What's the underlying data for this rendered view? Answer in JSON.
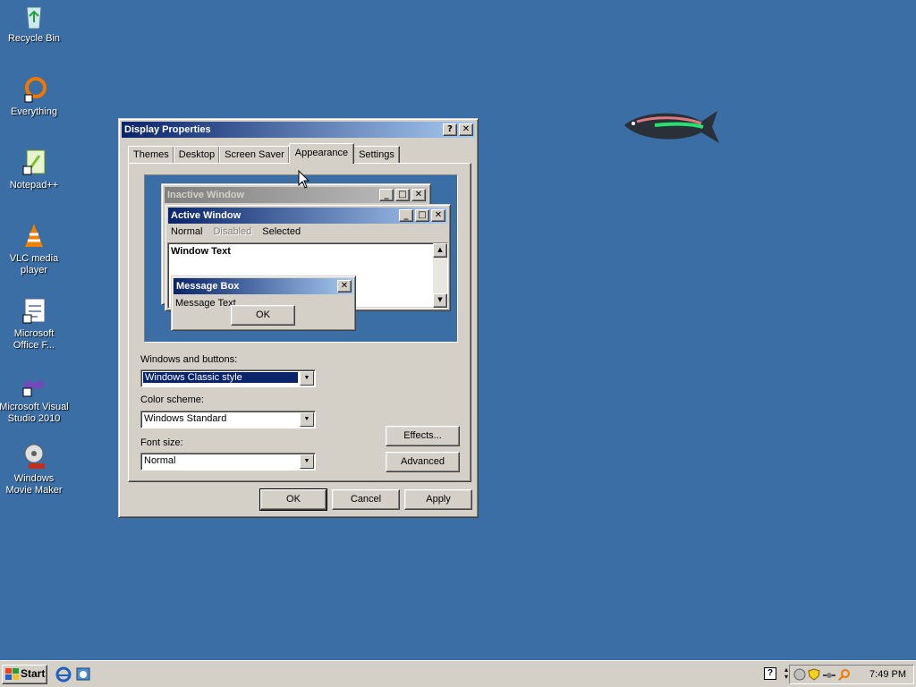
{
  "desktop": {
    "icons": [
      {
        "label": "Recycle Bin",
        "icon": "recycle-bin-icon"
      },
      {
        "label": "Everything",
        "icon": "everything-icon"
      },
      {
        "label": "Notepad++",
        "icon": "notepad-plus-plus-icon"
      },
      {
        "label": "VLC media player",
        "icon": "vlc-icon"
      },
      {
        "label": "Microsoft Office F...",
        "icon": "office-icon"
      },
      {
        "label": "Microsoft Visual Studio 2010",
        "icon": "visual-studio-icon"
      },
      {
        "label": "Windows Movie Maker",
        "icon": "movie-maker-icon"
      }
    ]
  },
  "dialog": {
    "title": "Display Properties",
    "help_btn": "?",
    "close_btn": "✕",
    "tabs": [
      "Themes",
      "Desktop",
      "Screen Saver",
      "Appearance",
      "Settings"
    ],
    "selected_tab": "Appearance",
    "preview": {
      "inactive_title": "Inactive Window",
      "active_title": "Active Window",
      "menu": [
        "Normal",
        "Disabled",
        "Selected"
      ],
      "window_text": "Window Text",
      "msgbox_title": "Message Box",
      "msgbox_text": "Message Text",
      "msgbox_ok": "OK"
    },
    "windows_buttons_label": "Windows and buttons:",
    "windows_buttons_value": "Windows Classic style",
    "color_scheme_label": "Color scheme:",
    "color_scheme_value": "Windows Standard",
    "font_size_label": "Font size:",
    "font_size_value": "Normal",
    "effects_btn": "Effects...",
    "advanced_btn": "Advanced",
    "ok_btn": "OK",
    "cancel_btn": "Cancel",
    "apply_btn": "Apply"
  },
  "taskbar": {
    "start_label": "Start",
    "clock": "7:49 PM"
  },
  "colors": {
    "desktop": "#3a6ea5",
    "title_active": "#0a246a",
    "face": "#d4d0c8"
  }
}
